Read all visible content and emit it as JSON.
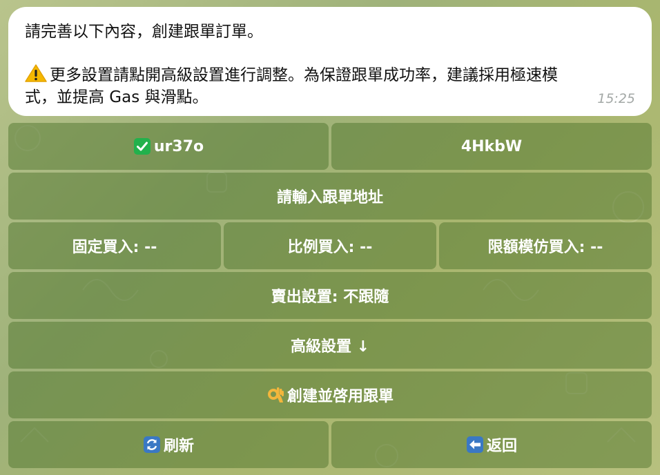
{
  "message": {
    "line1": "請完善以下內容，創建跟單訂單。",
    "line2": "更多設置請點開高級設置進行調整。為保證跟單成功率，建議採用極速模",
    "line3": "式，並提高 Gas 與滑點。",
    "time": "15:25"
  },
  "keyboard": {
    "wallet_selected": "ur37o",
    "wallet_other": "4HkbW",
    "enter_address": "請輸入跟單地址",
    "fixed_buy": "固定買入: --",
    "ratio_buy": "比例買入: --",
    "capped_copy_buy": "限額模仿買入: --",
    "sell_settings": "賣出設置: 不跟隨",
    "advanced_settings": "高級設置 ↓",
    "create_enable": "創建並啓用跟單",
    "refresh": "刷新",
    "back": "返回"
  },
  "icons": {
    "warning": "warning-icon",
    "check": "check-mark-icon",
    "ok_hand": "ok-hand-icon",
    "refresh": "refresh-icon",
    "back": "left-arrow-icon"
  },
  "colors": {
    "button_bg": "#6f8a4a",
    "bubble_bg": "#ffffff",
    "time": "#a3a8a6",
    "check": "#22b14c",
    "refresh": "#3a78c4",
    "back": "#3a78c4",
    "warning": "#f5b800"
  }
}
